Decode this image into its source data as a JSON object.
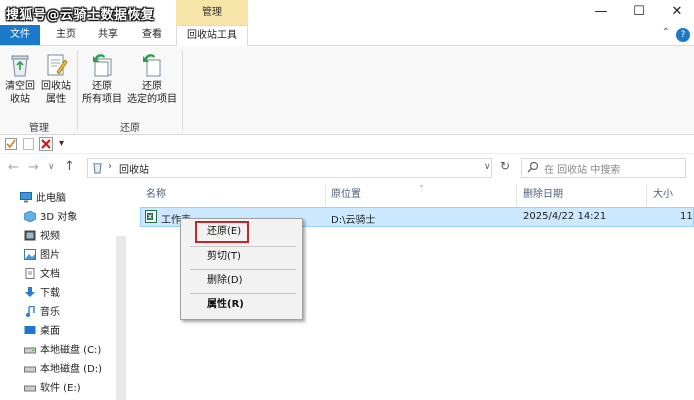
{
  "watermark": "搜狐号@云骑士数据恢复",
  "titlebar": {
    "context_tab": "管理",
    "minimize": "—",
    "maximize": "☐",
    "close": "✕"
  },
  "tabs": {
    "file": "文件",
    "home": "主页",
    "share": "共享",
    "view": "查看",
    "recycle_tools": "回收站工具"
  },
  "ribbon": {
    "empty_bin": [
      "清空回",
      "收站"
    ],
    "bin_props": [
      "回收站",
      "属性"
    ],
    "restore_all": [
      "还原",
      "所有项目"
    ],
    "restore_selected": [
      "还原",
      "选定的项目"
    ],
    "group_manage": "管理",
    "group_restore": "还原"
  },
  "qat": {
    "dropdown": "▾"
  },
  "address": {
    "separator": "›",
    "location": "回收站",
    "refresh": "↻"
  },
  "search": {
    "placeholder": "在 回收站 中搜索"
  },
  "nav": {
    "items": [
      "此电脑",
      "3D 对象",
      "视频",
      "图片",
      "文档",
      "下载",
      "音乐",
      "桌面",
      "本地磁盘 (C:)",
      "本地磁盘 (D:)",
      "软件 (E:)"
    ]
  },
  "columns": {
    "name": "名称",
    "original_location": "原位置",
    "deleted_date": "删除日期",
    "size": "大小"
  },
  "files": [
    {
      "name": "工作表",
      "original_location": "D:\\云骑士",
      "deleted_date": "2025/4/22 14:21",
      "size": "11"
    }
  ],
  "context_menu": {
    "restore": "还原(E)",
    "cut": "剪切(T)",
    "delete": "删除(D)",
    "properties": "属性(R)"
  },
  "colors": {
    "accent": "#1979ca",
    "selection": "#cce8ff",
    "context_tab": "#f6e4a8",
    "highlight": "#c0272d"
  }
}
